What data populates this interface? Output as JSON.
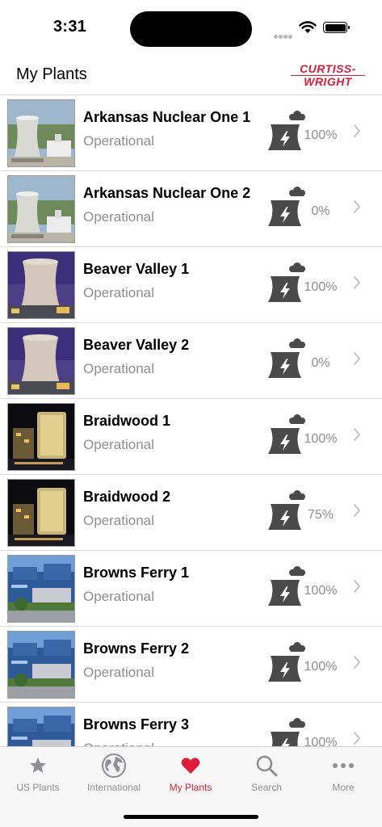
{
  "status_bar": {
    "time": "3:31"
  },
  "header": {
    "title": "My Plants",
    "brand_line1": "CURTISS-",
    "brand_line2": "WRIGHT",
    "brand_color": "#e31b37"
  },
  "plants": [
    {
      "name": "Arkansas Nuclear One 1",
      "status": "Operational",
      "power": "100%",
      "thumb": "cooling-tower-day"
    },
    {
      "name": "Arkansas Nuclear One 2",
      "status": "Operational",
      "power": "0%",
      "thumb": "cooling-tower-day"
    },
    {
      "name": "Beaver Valley 1",
      "status": "Operational",
      "power": "100%",
      "thumb": "cooling-tower-dusk"
    },
    {
      "name": "Beaver Valley 2",
      "status": "Operational",
      "power": "0%",
      "thumb": "cooling-tower-dusk"
    },
    {
      "name": "Braidwood 1",
      "status": "Operational",
      "power": "100%",
      "thumb": "plant-night"
    },
    {
      "name": "Braidwood 2",
      "status": "Operational",
      "power": "75%",
      "thumb": "plant-night"
    },
    {
      "name": "Browns Ferry 1",
      "status": "Operational",
      "power": "100%",
      "thumb": "blue-buildings"
    },
    {
      "name": "Browns Ferry 2",
      "status": "Operational",
      "power": "100%",
      "thumb": "blue-buildings"
    },
    {
      "name": "Browns Ferry 3",
      "status": "Operational",
      "power": "100%",
      "thumb": "blue-buildings"
    }
  ],
  "tabs": [
    {
      "label": "US Plants",
      "icon": "star-icon",
      "active": false
    },
    {
      "label": "International",
      "icon": "globe-icon",
      "active": false
    },
    {
      "label": "My Plants",
      "icon": "heart-icon",
      "active": true
    },
    {
      "label": "Search",
      "icon": "magnifier-icon",
      "active": false
    },
    {
      "label": "More",
      "icon": "ellipsis-icon",
      "active": false
    }
  ],
  "colors": {
    "accent": "#e31b37",
    "icon_gray": "#4a4a4a",
    "secondary_text": "#8e8e93"
  }
}
